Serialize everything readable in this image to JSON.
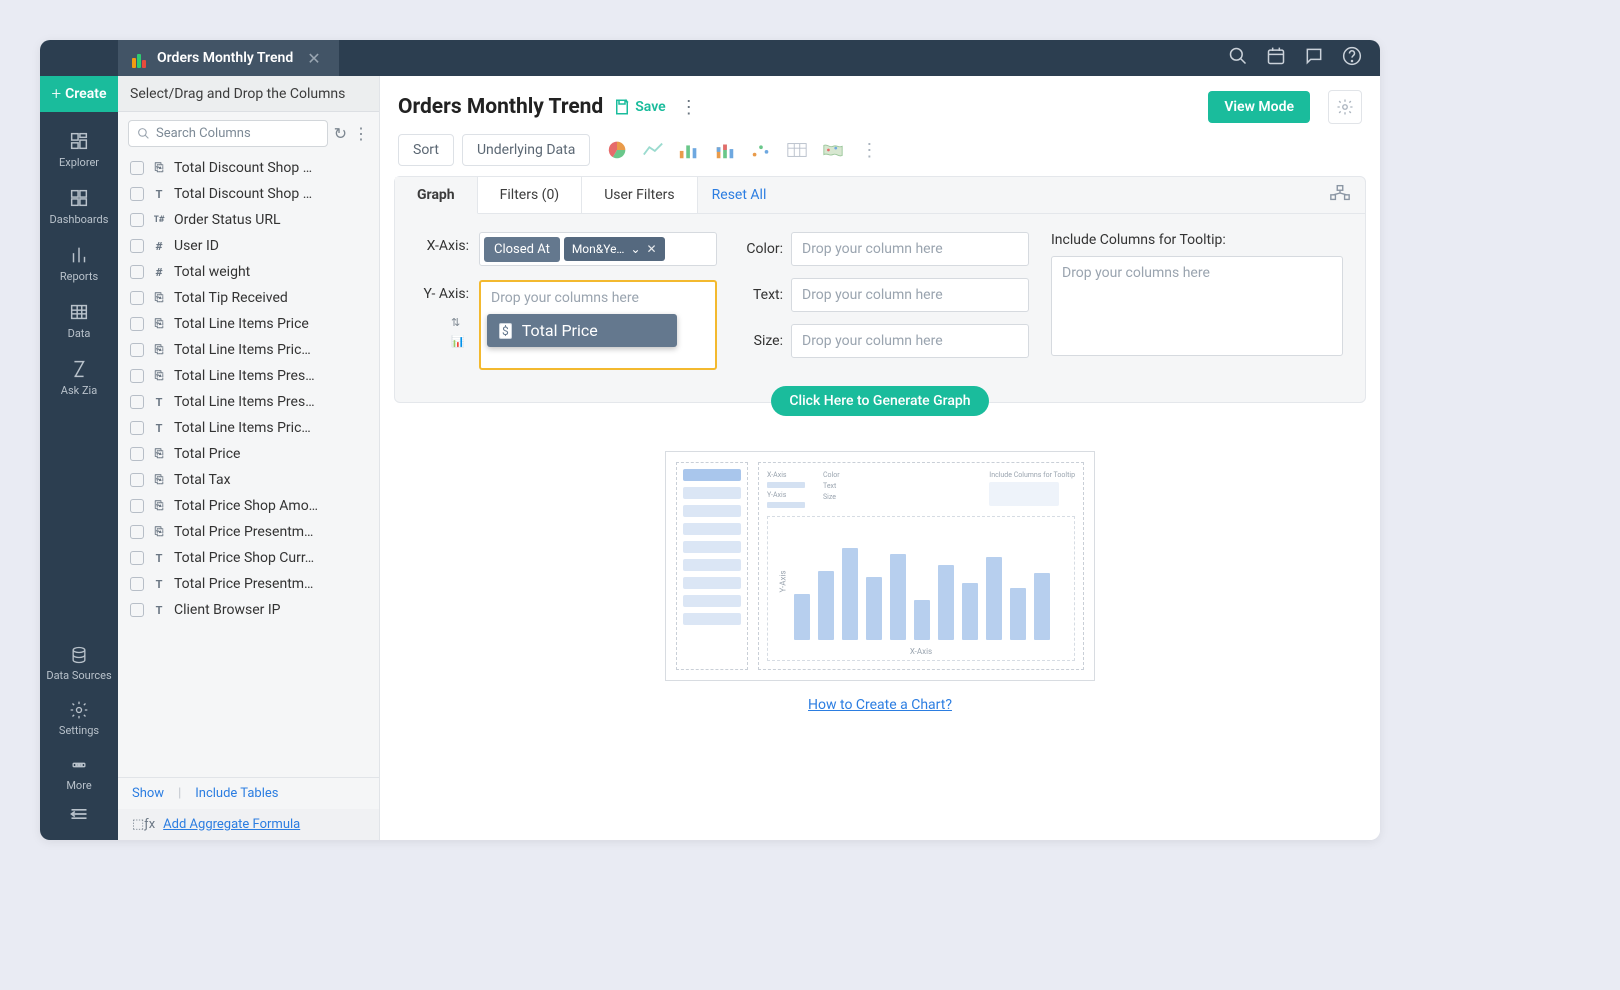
{
  "tab": {
    "title": "Orders Monthly Trend"
  },
  "sidenav": {
    "create": "Create",
    "items": [
      "Explorer",
      "Dashboards",
      "Reports",
      "Data",
      "Ask Zia",
      "Data Sources",
      "Settings",
      "More"
    ]
  },
  "colpanel": {
    "header": "Select/Drag and Drop the Columns",
    "search_placeholder": "Search Columns",
    "columns": [
      {
        "type": "$",
        "label": "Total Discount Shop …"
      },
      {
        "type": "T",
        "label": "Total Discount Shop …"
      },
      {
        "type": "T#",
        "label": "Order Status URL"
      },
      {
        "type": "#",
        "label": "User ID"
      },
      {
        "type": "#",
        "label": "Total weight"
      },
      {
        "type": "$",
        "label": "Total Tip Received"
      },
      {
        "type": "$",
        "label": "Total Line Items Price"
      },
      {
        "type": "$",
        "label": "Total Line Items Pric…"
      },
      {
        "type": "$",
        "label": "Total Line Items Pres…"
      },
      {
        "type": "T",
        "label": "Total Line Items Pres…"
      },
      {
        "type": "T",
        "label": "Total Line Items Pric…"
      },
      {
        "type": "$",
        "label": "Total Price"
      },
      {
        "type": "$",
        "label": "Total Tax"
      },
      {
        "type": "$",
        "label": "Total Price Shop Amo…"
      },
      {
        "type": "$",
        "label": "Total Price Presentm…"
      },
      {
        "type": "T",
        "label": "Total Price Shop Curr…"
      },
      {
        "type": "T",
        "label": "Total Price Presentm…"
      },
      {
        "type": "T",
        "label": "Client Browser IP"
      }
    ],
    "footer": {
      "show": "Show",
      "include": "Include Tables",
      "formula": "Add Aggregate Formula"
    }
  },
  "main": {
    "title": "Orders Monthly Trend",
    "save": "Save",
    "viewmode": "View Mode",
    "toolbar": {
      "sort": "Sort",
      "underlying": "Underlying Data"
    },
    "tabs": {
      "graph": "Graph",
      "filters": "Filters  (0)",
      "userfilters": "User Filters",
      "reset": "Reset All"
    },
    "xaxis": {
      "label": "X-Axis:",
      "pill": "Closed At",
      "func": "Mon&Ye…"
    },
    "yaxis": {
      "label": "Y- Axis:",
      "placeholder": "Drop your columns here",
      "drag": "Total Price"
    },
    "props": {
      "color": "Color:",
      "text": "Text:",
      "size": "Size:",
      "placeholder": "Drop your column here"
    },
    "tooltip": {
      "label": "Include Columns for Tooltip:",
      "placeholder": "Drop your columns here"
    },
    "generate": "Click Here to Generate Graph",
    "preview": {
      "xlabel": "X-Axis",
      "ylabel": "Y-Axis",
      "ctrl": [
        "X-Axis",
        "Y-Axis",
        "Color",
        "Text",
        "Size",
        "Include Columns for Tooltip"
      ]
    },
    "howto": "How to Create a Chart?"
  }
}
